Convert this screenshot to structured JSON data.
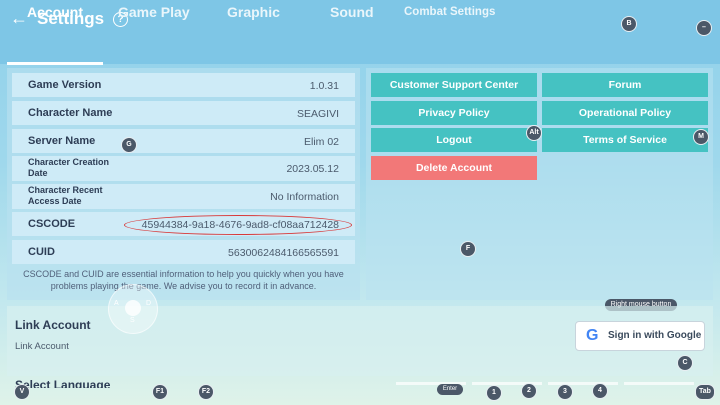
{
  "header": {
    "back_icon": "arrow-left-icon",
    "title": "Settings",
    "help_glyph": "?"
  },
  "tabs": [
    {
      "label": "Account"
    },
    {
      "label": "Game Play"
    },
    {
      "label": "Graphic"
    },
    {
      "label": "Sound"
    },
    {
      "label": "Combat Settings"
    }
  ],
  "account_info": [
    {
      "label": "Game Version",
      "value": "1.0.31"
    },
    {
      "label": "Character Name",
      "value": "SEAGIVI"
    },
    {
      "label": "Server Name",
      "value": "Elim 02"
    },
    {
      "label": "Character Creation Date",
      "value": "2023.05.12"
    },
    {
      "label": "Character Recent Access Date",
      "value": "No Information"
    },
    {
      "label": "CSCODE",
      "value": "45944384-9a18-4676-9ad8-cf08aa712428"
    },
    {
      "label": "CUID",
      "value": "5630062484166565591"
    }
  ],
  "note": "CSCODE and CUID are essential information to help you quickly when you have problems playing the game. We advise you to record it in advance.",
  "buttons": {
    "customer_support": "Customer Support Center",
    "forum": "Forum",
    "privacy": "Privacy Policy",
    "operational": "Operational Policy",
    "logout": "Logout",
    "terms": "Terms of Service",
    "delete": "Delete Account"
  },
  "link_account": {
    "title": "Link Account",
    "subtitle": "Link Account",
    "google_label": "Sign in with Google",
    "google_glyph": "G"
  },
  "select_language": {
    "title": "Select Language"
  },
  "hints": {
    "right_mouse": "Right mouse button",
    "enter": "Enter",
    "keys": {
      "B": "B",
      "minus": "–",
      "G": "G",
      "Alt": "Alt",
      "M": "M",
      "F": "F",
      "C": "C",
      "V": "V",
      "F1": "F1",
      "F2": "F2",
      "n1": "1",
      "n2": "2",
      "n3": "3",
      "n4": "4",
      "Tab": "Tab"
    },
    "joystick": {
      "A": "A",
      "D": "D",
      "S": "S"
    }
  },
  "colors": {
    "header": "#7ec6e6",
    "teal_button": "#45c2c2",
    "delete_button": "#f27878",
    "highlight_oval": "#d83a3a"
  }
}
